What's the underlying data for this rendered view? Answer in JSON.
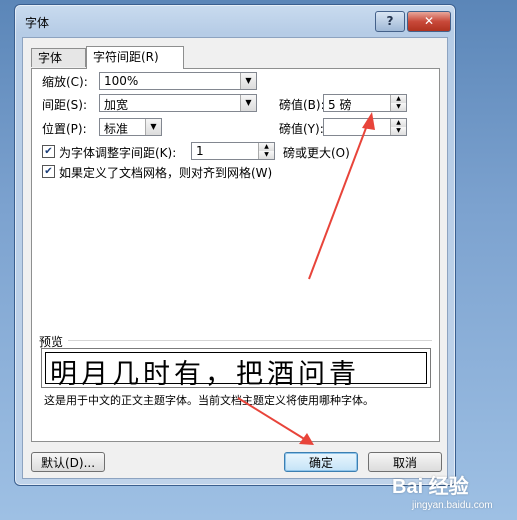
{
  "window": {
    "title": "字体",
    "help_label": "?",
    "close_label": "✕"
  },
  "tabs": [
    {
      "label": "字体(N)",
      "active": false
    },
    {
      "label": "字符间距(R)",
      "active": true
    }
  ],
  "spacing": {
    "scale_label": "缩放(C):",
    "scale_value": "100%",
    "spacing_label": "间距(S):",
    "spacing_value": "加宽",
    "spacing_by_label": "磅值(B):",
    "spacing_by_value": "5 磅",
    "position_label": "位置(P):",
    "position_value": "标准",
    "position_by_label": "磅值(Y):",
    "position_by_value": "",
    "kerning_label": "为字体调整字间距(K):",
    "kerning_checked": true,
    "kerning_value": "1",
    "kerning_suffix": "磅或更大(O)",
    "grid_label": "如果定义了文档网格，则对齐到网格(W)",
    "grid_checked": true
  },
  "preview": {
    "heading": "预览",
    "sample": "明月几时有，把酒问青",
    "note": "这是用于中文的正文主题字体。当前文档主题定义将使用哪种字体。"
  },
  "buttons": {
    "default_label": "默认(D)...",
    "ok_label": "确定",
    "cancel_label": "取消"
  },
  "watermark": {
    "brand": "Bai 经验",
    "url": "jingyan.baidu.com"
  },
  "annotation_color": "#e8443a"
}
